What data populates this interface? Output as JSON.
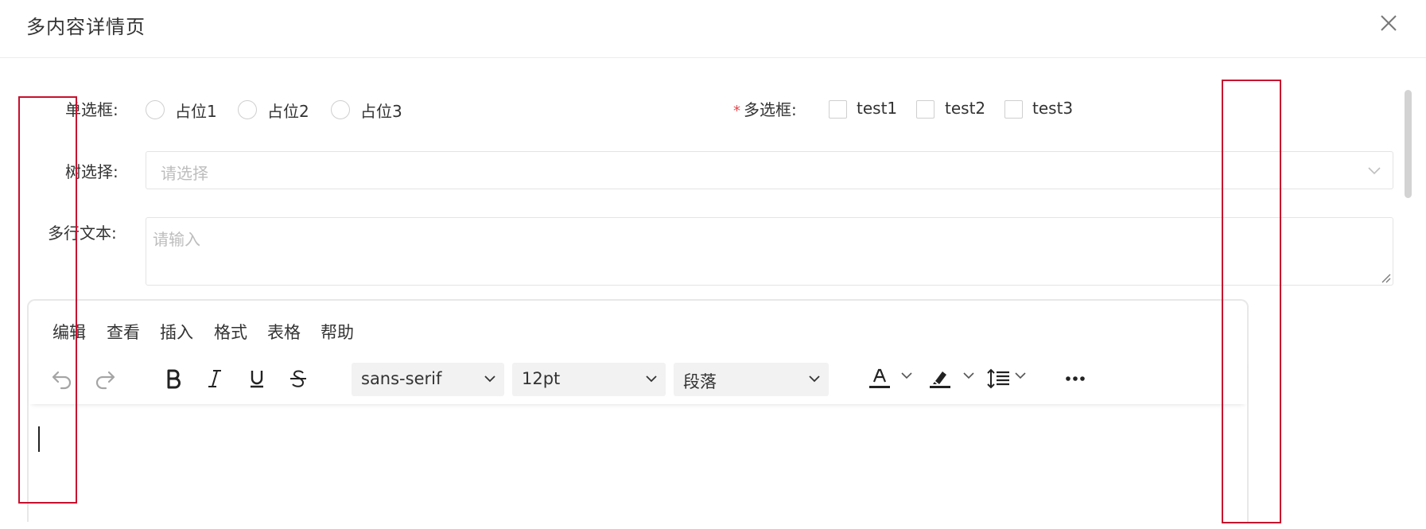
{
  "dialog": {
    "title": "多内容详情页"
  },
  "form": {
    "radio": {
      "label": "单选框:",
      "options": [
        "占位1",
        "占位2",
        "占位3"
      ]
    },
    "checkbox": {
      "required_mark": "*",
      "label": "多选框:",
      "options": [
        "test1",
        "test2",
        "test3"
      ]
    },
    "tree_select": {
      "label": "树选择:",
      "placeholder": "请选择"
    },
    "textarea": {
      "label": "多行文本:",
      "placeholder": "请输入"
    }
  },
  "editor": {
    "menu": [
      "编辑",
      "查看",
      "插入",
      "格式",
      "表格",
      "帮助"
    ],
    "toolbar": {
      "font_family": "sans-serif",
      "font_size": "12pt",
      "block_format": "段落"
    }
  },
  "colors": {
    "annotation_box": "#c8102e",
    "required": "#e5484d",
    "icon": "#222222",
    "icon_disabled": "#a5a5a5"
  }
}
